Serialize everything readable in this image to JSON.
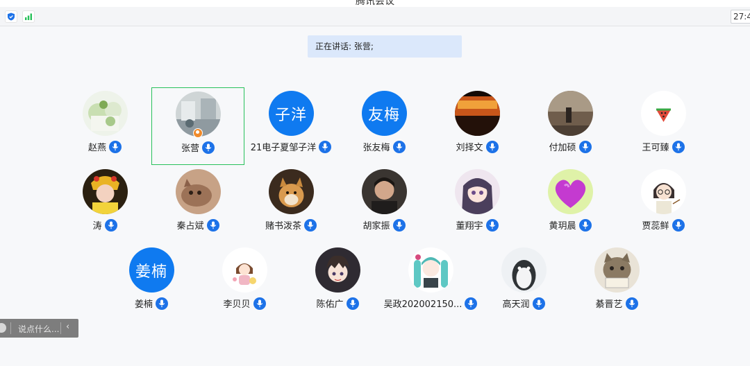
{
  "window": {
    "title": "腾讯会议",
    "timer": "27:4"
  },
  "banner": {
    "label": "正在讲话: 张营;"
  },
  "participants": [
    {
      "name": "赵燕",
      "avatar": "photo-drink"
    },
    {
      "name": "张营",
      "avatar": "photo-room",
      "active": true,
      "host": true
    },
    {
      "name": "21电子夏邹子洋",
      "avatar_text": "子洋"
    },
    {
      "name": "张友梅",
      "avatar_text": "友梅"
    },
    {
      "name": "刘择文",
      "avatar": "photo-fire"
    },
    {
      "name": "付加硕",
      "avatar": "photo-street"
    },
    {
      "name": "王可臻",
      "avatar": "watermelon-icon"
    },
    {
      "name": "涛",
      "avatar": "photo-opera"
    },
    {
      "name": "秦占斌",
      "avatar": "photo-cat"
    },
    {
      "name": "赌书泼茶",
      "avatar": "photo-shiba"
    },
    {
      "name": "胡家振",
      "avatar": "photo-man"
    },
    {
      "name": "董翔宇",
      "avatar": "anime-girl"
    },
    {
      "name": "黄玥晨",
      "avatar": "photo-heart"
    },
    {
      "name": "贾蕊鲜",
      "avatar": "cartoon-teacher"
    },
    {
      "name": "姜楠",
      "avatar_text": "姜楠"
    },
    {
      "name": "李贝贝",
      "avatar": "cartoon-girl"
    },
    {
      "name": "陈佑广",
      "avatar": "anime-boy"
    },
    {
      "name": "吴政202002150...",
      "avatar": "anime-miku"
    },
    {
      "name": "高天润",
      "avatar": "photo-penguin"
    },
    {
      "name": "綦晋艺",
      "avatar": "photo-cat-sign"
    }
  ],
  "chat": {
    "placeholder": "说点什么..."
  },
  "colors": {
    "accent": "#0f7af0",
    "active_border": "#27c15a",
    "banner_bg": "#dbe8fb",
    "mic": "#1d72e8"
  }
}
